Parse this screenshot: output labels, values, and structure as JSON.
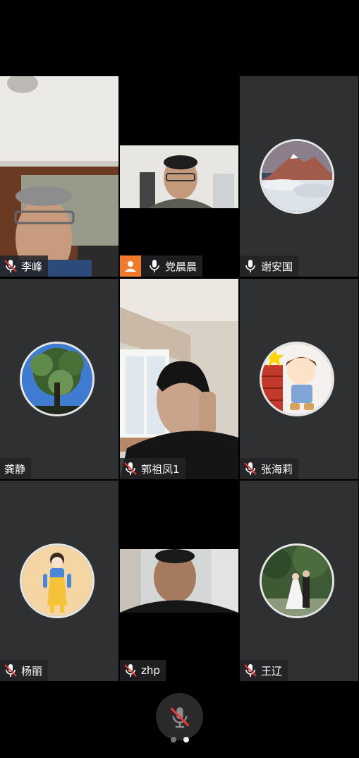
{
  "participants": [
    {
      "name": "李峰",
      "mic": "muted",
      "view": "video"
    },
    {
      "name": "党晨晨",
      "mic": "on",
      "view": "video"
    },
    {
      "name": "谢安国",
      "mic": "on",
      "view": "avatar"
    },
    {
      "name": "龚静",
      "mic": "none",
      "view": "avatar"
    },
    {
      "name": "郭祖凤1",
      "mic": "muted",
      "view": "video"
    },
    {
      "name": "张海莉",
      "mic": "muted",
      "view": "avatar"
    },
    {
      "name": "杨丽",
      "mic": "muted",
      "view": "avatar"
    },
    {
      "name": "zhp",
      "mic": "muted",
      "view": "video"
    },
    {
      "name": "王辽",
      "mic": "muted",
      "view": "avatar"
    }
  ],
  "controls": {
    "self_mic": "muted"
  },
  "pagination": {
    "pages": 2,
    "current": 2
  },
  "colors": {
    "tile_bg": "#2f3032",
    "user_icon_bg": "#f07b2e",
    "mute_slash": "#e53935"
  }
}
